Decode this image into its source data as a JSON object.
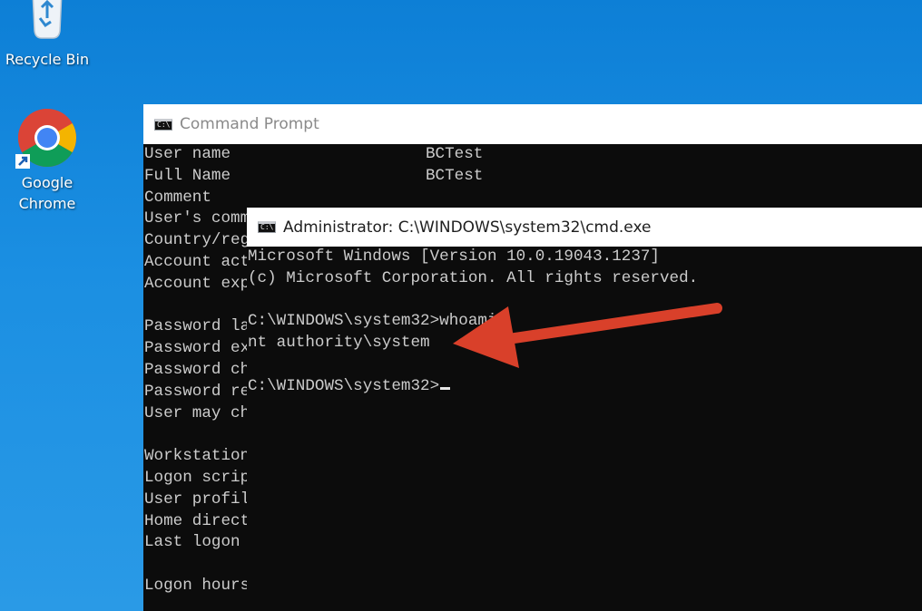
{
  "desktop": {
    "background_color": "#1a8ce0",
    "icons": [
      {
        "label": "Recycle Bin",
        "icon": "recycle-bin-icon"
      },
      {
        "label_line1": "Google",
        "label_line2": "Chrome",
        "icon": "chrome-icon"
      }
    ]
  },
  "back_window": {
    "title": "Command Prompt",
    "icon": "cmd-icon",
    "lines": [
      {
        "key": "User name",
        "value": "BCTest"
      },
      {
        "key": "Full Name",
        "value": "BCTest"
      },
      {
        "key": "Comment",
        "value": ""
      },
      {
        "key": "User's comm",
        "value": ""
      },
      {
        "key": "Country/reg",
        "value": ""
      },
      {
        "key": "Account act",
        "value": ""
      },
      {
        "key": "Account exp",
        "value": ""
      },
      {
        "key": "",
        "value": ""
      },
      {
        "key": "Password la",
        "value": ""
      },
      {
        "key": "Password ex",
        "value": ""
      },
      {
        "key": "Password ch",
        "value": ""
      },
      {
        "key": "Password re",
        "value": ""
      },
      {
        "key": "User may ch",
        "value": ""
      },
      {
        "key": "",
        "value": ""
      },
      {
        "key": "Workstation",
        "value": ""
      },
      {
        "key": "Logon scrip",
        "value": ""
      },
      {
        "key": "User profil",
        "value": ""
      },
      {
        "key": "Home direct",
        "value": ""
      },
      {
        "key": "Last logon",
        "value": ""
      },
      {
        "key": "",
        "value": ""
      },
      {
        "key": "Logon hours",
        "value": ""
      }
    ]
  },
  "front_window": {
    "title": "Administrator: C:\\WINDOWS\\system32\\cmd.exe",
    "icon": "cmd-icon",
    "lines": [
      "Microsoft Windows [Version 10.0.19043.1237]",
      "(c) Microsoft Corporation. All rights reserved.",
      "",
      "C:\\WINDOWS\\system32>whoami",
      "nt authority\\system",
      "",
      "C:\\WINDOWS\\system32>"
    ]
  },
  "annotation": {
    "type": "arrow",
    "color": "#d9402a",
    "points_to": "nt authority\\system"
  },
  "console_colors": {
    "background": "#0c0c0c",
    "text": "#cccccc"
  }
}
